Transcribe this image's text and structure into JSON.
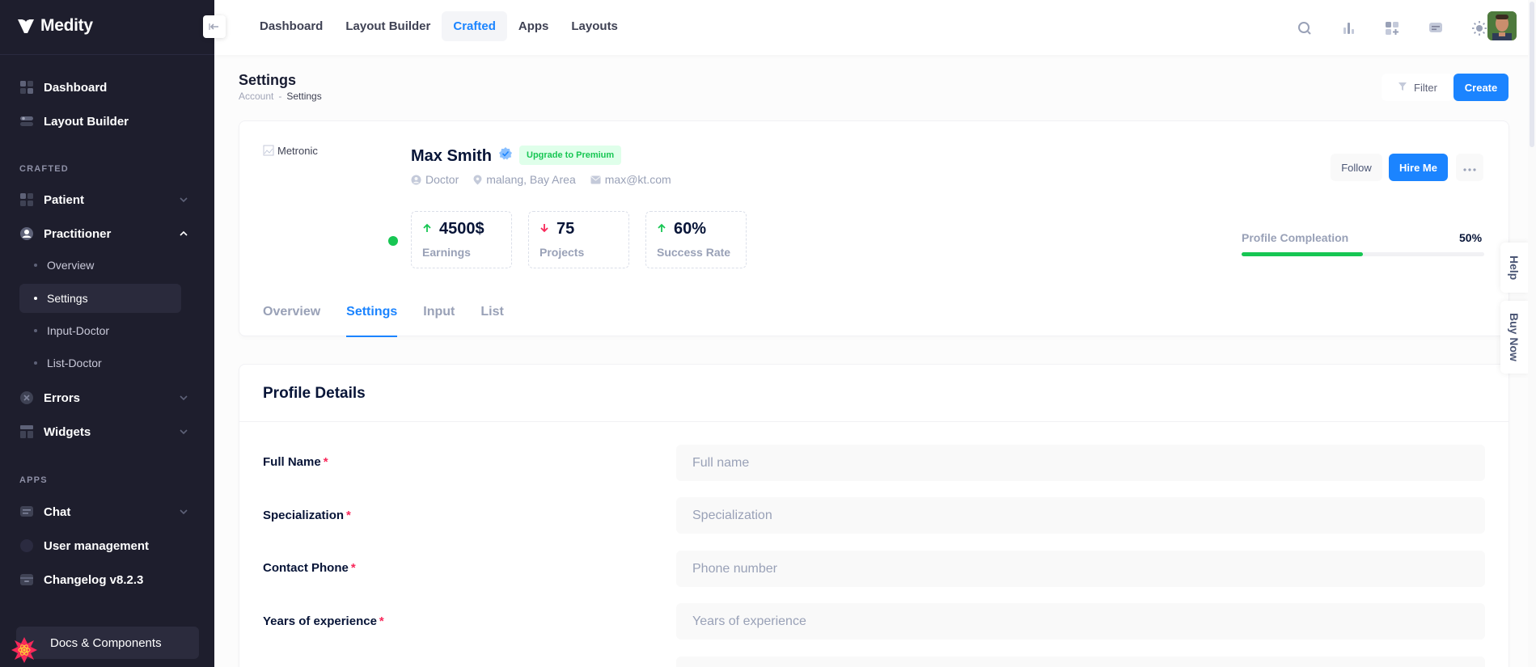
{
  "brand": {
    "name": "Medity"
  },
  "sidebar": {
    "items_top": [
      {
        "label": "Dashboard",
        "icon": "dashboard-icon"
      },
      {
        "label": "Layout Builder",
        "icon": "layout-icon"
      }
    ],
    "section_crafted": "CRAFTED",
    "crafted_items": [
      {
        "label": "Patient",
        "icon": "patient-icon"
      },
      {
        "label": "Practitioner",
        "icon": "practitioner-icon"
      }
    ],
    "practitioner_sub": [
      {
        "label": "Overview",
        "active": false
      },
      {
        "label": "Settings",
        "active": true
      },
      {
        "label": "Input-Doctor",
        "active": false
      },
      {
        "label": "List-Doctor",
        "active": false
      }
    ],
    "crafted_more": [
      {
        "label": "Errors",
        "icon": "errors-icon"
      },
      {
        "label": "Widgets",
        "icon": "widgets-icon"
      }
    ],
    "section_apps": "APPS",
    "apps_items": [
      {
        "label": "Chat",
        "icon": "chat-icon"
      },
      {
        "label": "User management",
        "icon": "users-icon"
      },
      {
        "label": "Changelog v8.2.3",
        "icon": "changelog-icon"
      }
    ],
    "docs_label": "Docs & Components"
  },
  "header": {
    "nav": [
      {
        "label": "Dashboard",
        "active": false
      },
      {
        "label": "Layout Builder",
        "active": false
      },
      {
        "label": "Crafted",
        "active": true
      },
      {
        "label": "Apps",
        "active": false
      },
      {
        "label": "Layouts",
        "active": false
      }
    ],
    "icons": [
      "search-icon",
      "chart-icon",
      "apps-grid-icon",
      "chat-bubble-icon",
      "theme-sun-icon"
    ]
  },
  "toolbar": {
    "title": "Settings",
    "breadcrumb": [
      "Account",
      "-",
      "Settings"
    ],
    "filter_label": "Filter",
    "create_label": "Create"
  },
  "profile": {
    "image_alt": "Metronic",
    "name": "Max Smith",
    "premium_badge": "Upgrade to Premium",
    "role": "Doctor",
    "location": "malang, Bay Area",
    "email": "max@kt.com",
    "stats": [
      {
        "value": "4500$",
        "label": "Earnings",
        "trend": "up"
      },
      {
        "value": "75",
        "label": "Projects",
        "trend": "down"
      },
      {
        "value": "60%",
        "label": "Success Rate",
        "trend": "up"
      }
    ],
    "follow_label": "Follow",
    "hire_label": "Hire Me",
    "completion_label": "Profile Compleation",
    "completion_value": "50%",
    "completion_fraction": 0.5,
    "tabs": [
      {
        "label": "Overview",
        "active": false
      },
      {
        "label": "Settings",
        "active": true
      },
      {
        "label": "Input",
        "active": false
      },
      {
        "label": "List",
        "active": false
      }
    ]
  },
  "details": {
    "title": "Profile Details",
    "fields": [
      {
        "label": "Full Name",
        "placeholder": "Full name"
      },
      {
        "label": "Specialization",
        "placeholder": "Specialization"
      },
      {
        "label": "Contact Phone",
        "placeholder": "Phone number"
      },
      {
        "label": "Years of experience",
        "placeholder": "Years of experience"
      }
    ]
  },
  "side_tabs": {
    "help": "Help",
    "buy_now": "Buy Now"
  },
  "colors": {
    "primary": "#1b84ff",
    "success": "#17c653",
    "danger": "#f8285a",
    "sidebar": "#1e1e2d"
  }
}
